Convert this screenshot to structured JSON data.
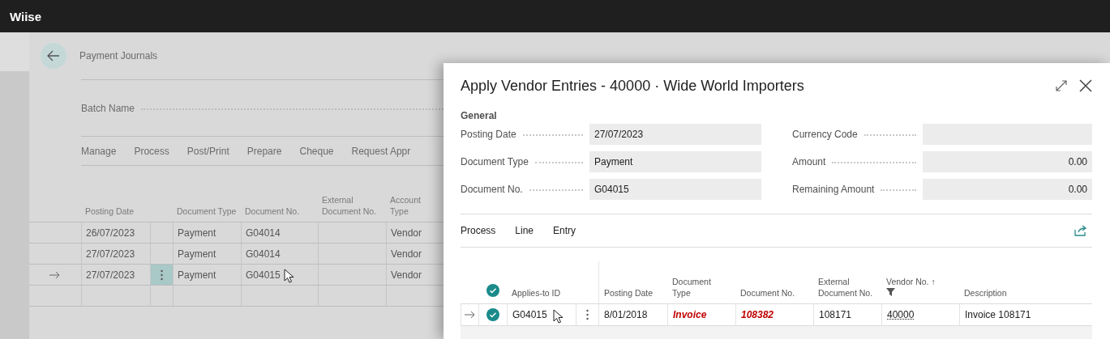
{
  "app_bar": {
    "title": "Wiise"
  },
  "journal": {
    "title": "Payment Journals",
    "batch_label": "Batch Name",
    "actions": [
      "Manage",
      "Process",
      "Post/Print",
      "Prepare",
      "Cheque",
      "Request Appr"
    ],
    "columns": [
      "Posting Date",
      "Document Type",
      "Document No.",
      "External Document No.",
      "Account Type"
    ],
    "rows": [
      {
        "current": false,
        "cells": [
          "26/07/2023",
          "Payment",
          "G04014",
          "",
          "Vendor"
        ]
      },
      {
        "current": false,
        "cells": [
          "27/07/2023",
          "Payment",
          "G04014",
          "",
          "Vendor"
        ]
      },
      {
        "current": true,
        "cells": [
          "27/07/2023",
          "Payment",
          "G04015",
          "",
          "Vendor"
        ]
      }
    ]
  },
  "dialog": {
    "title": "Apply Vendor Entries - 40000 · Wide World Importers",
    "section": "General",
    "fields": [
      {
        "label": "Posting Date",
        "value": "27/07/2023",
        "kind": "text"
      },
      {
        "label": "Currency Code",
        "kind": "text"
      },
      {
        "label": "Document Type",
        "value": "Payment",
        "kind": "text"
      },
      {
        "label": "Amount",
        "value": "0.00",
        "kind": "amount"
      },
      {
        "label": "Document No.",
        "value": "G04015",
        "kind": "text"
      },
      {
        "label": "Remaining Amount",
        "value": "0.00",
        "kind": "amount"
      }
    ],
    "actions": [
      "Process",
      "Line",
      "Entry"
    ],
    "all_checked": true,
    "columns": [
      {
        "label": "Applies-to ID"
      },
      {
        "label": "Posting Date"
      },
      {
        "label": "Document Type"
      },
      {
        "label": "Document No."
      },
      {
        "label": "External Document No."
      },
      {
        "label": "Vendor No.",
        "sort": "↑",
        "filtered": true
      },
      {
        "label": "Description"
      }
    ],
    "rows": [
      {
        "current": true,
        "checked": true,
        "cells": [
          {
            "text": "G04015",
            "kind": "normal"
          },
          {
            "text": "8/01/2018",
            "kind": "normal"
          },
          {
            "text": "Invoice",
            "kind": "attention"
          },
          {
            "text": "108382",
            "kind": "attention"
          },
          {
            "text": "108171",
            "kind": "normal"
          },
          {
            "text": "40000",
            "kind": "link"
          },
          {
            "text": "Invoice 108171",
            "kind": "normal"
          }
        ]
      }
    ]
  }
}
